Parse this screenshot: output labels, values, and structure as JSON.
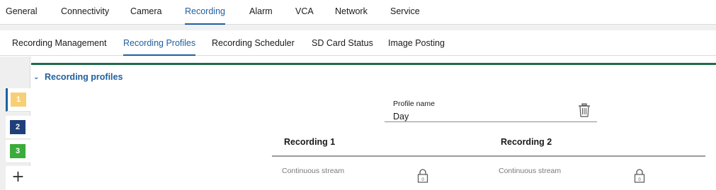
{
  "top_nav": {
    "tabs": [
      {
        "label": "General"
      },
      {
        "label": "Connectivity"
      },
      {
        "label": "Camera"
      },
      {
        "label": "Recording"
      },
      {
        "label": "Alarm"
      },
      {
        "label": "VCA"
      },
      {
        "label": "Network"
      },
      {
        "label": "Service"
      }
    ],
    "active": "Recording"
  },
  "sub_nav": {
    "tabs": [
      {
        "label": "Recording Management"
      },
      {
        "label": "Recording Profiles"
      },
      {
        "label": "Recording Scheduler"
      },
      {
        "label": "SD Card Status"
      },
      {
        "label": "Image Posting"
      }
    ],
    "active": "Recording Profiles"
  },
  "profile_rail": {
    "items": [
      {
        "label": "1",
        "color": "#f7cf76",
        "active": true
      },
      {
        "label": "2",
        "color": "#1f3f7a",
        "active": false
      },
      {
        "label": "3",
        "color": "#3bab3a",
        "active": false
      }
    ],
    "add_icon": "plus-icon"
  },
  "section": {
    "title": "Recording profiles",
    "icon": "chevron-down-icon"
  },
  "profile": {
    "name_label": "Profile name",
    "name_value": "Day",
    "delete_icon": "trash-icon"
  },
  "recordings": [
    {
      "title": "Recording 1",
      "stream": "Continuous stream",
      "lock_icon": "lock-icon",
      "lock_text": "0"
    },
    {
      "title": "Recording 2",
      "stream": "Continuous stream",
      "lock_icon": "lock-icon",
      "lock_text": "0"
    }
  ],
  "colors": {
    "accent": "#1f5fa0",
    "section_bar": "#1e6b4a"
  }
}
